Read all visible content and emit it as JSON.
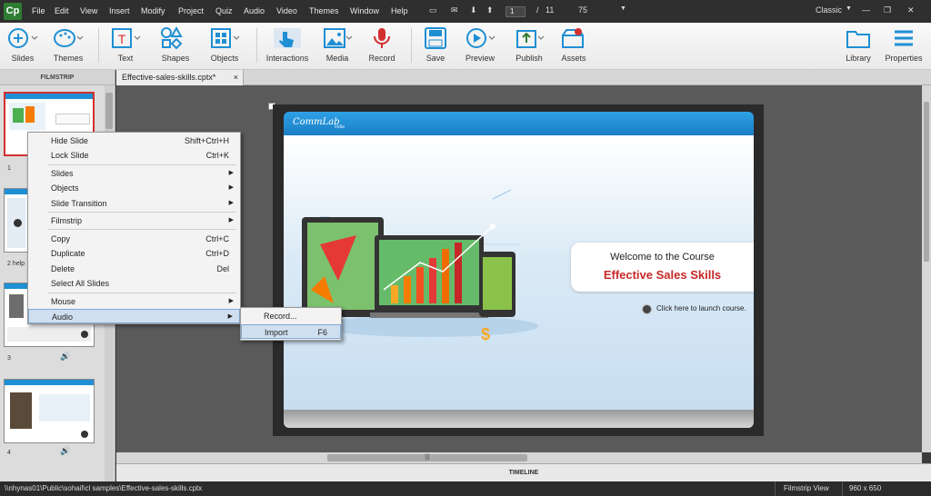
{
  "menubar": {
    "logo": "Cp",
    "items": [
      "File",
      "Edit",
      "View",
      "Insert",
      "Modify",
      "Project",
      "Quiz",
      "Audio",
      "Video",
      "Themes",
      "Window",
      "Help"
    ],
    "current_slide": "1",
    "slide_separator": "/",
    "total_slides": "11",
    "zoom": "75",
    "workspace": "Classic"
  },
  "toolbar": {
    "slides": "Slides",
    "themes": "Themes",
    "text": "Text",
    "shapes": "Shapes",
    "objects": "Objects",
    "interactions": "Interactions",
    "media": "Media",
    "record": "Record",
    "save": "Save",
    "preview": "Preview",
    "publish": "Publish",
    "assets": "Assets",
    "library": "Library",
    "properties": "Properties",
    "accent": "#1f8fd4"
  },
  "filmstrip": {
    "title": "FILMSTRIP",
    "slides": [
      {
        "number": "1"
      },
      {
        "number": "2 help"
      },
      {
        "number": "3"
      },
      {
        "number": "4"
      }
    ]
  },
  "document": {
    "tab": "Effective-sales-skills.cptx*",
    "close": "×"
  },
  "slide": {
    "brand": "CommLab",
    "brand_sub": "India",
    "welcome": "Welcome to the Course",
    "course_title": "Effective Sales Skills",
    "course_title_color": "#c62828",
    "launch": "Click here to launch course."
  },
  "context_menu": [
    {
      "label": "Hide Slide",
      "shortcut": "Shift+Ctrl+H"
    },
    {
      "label": "Lock Slide",
      "shortcut": "Ctrl+K"
    },
    {
      "label": "Slides",
      "submenu": true
    },
    {
      "label": "Objects",
      "submenu": true
    },
    {
      "label": "Slide Transition",
      "submenu": true
    },
    {
      "label": "Filmstrip",
      "submenu": true
    },
    {
      "label": "Copy",
      "shortcut": "Ctrl+C"
    },
    {
      "label": "Duplicate",
      "shortcut": "Ctrl+D"
    },
    {
      "label": "Delete",
      "shortcut": "Del"
    },
    {
      "label": "Select All Slides"
    },
    {
      "label": "Mouse",
      "submenu": true
    },
    {
      "label": "Audio",
      "submenu": true
    }
  ],
  "audio_submenu": [
    {
      "label": "Record..."
    },
    {
      "label": "Import",
      "shortcut": "F6"
    }
  ],
  "timeline": {
    "label": "TIMELINE"
  },
  "statusbar": {
    "path": "\\\\nhynas01\\Public\\sohail\\cl samples\\Effective-sales-skills.cptx",
    "view": "Filmstrip View",
    "size": "960 x 650"
  }
}
